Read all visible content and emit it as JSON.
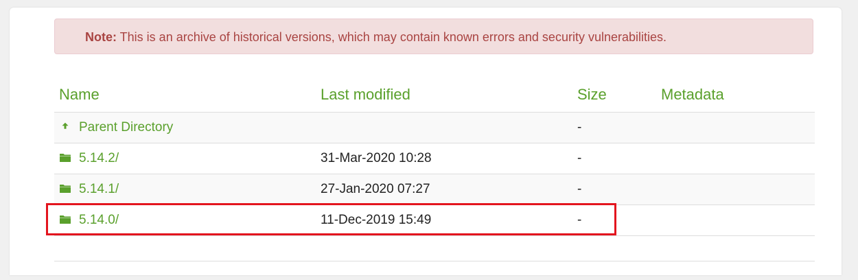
{
  "note": {
    "label": "Note:",
    "text": " This is an archive of historical versions, which may contain known errors and security vulnerabilities."
  },
  "table": {
    "headers": {
      "name": "Name",
      "modified": "Last modified",
      "size": "Size",
      "metadata": "Metadata"
    },
    "rows": [
      {
        "name": "Parent Directory",
        "modified": "",
        "size": "-",
        "icon": "arrow-up-icon"
      },
      {
        "name": "5.14.2/",
        "modified": "31-Mar-2020 10:28",
        "size": "-",
        "icon": "folder-icon"
      },
      {
        "name": "5.14.1/",
        "modified": "27-Jan-2020 07:27",
        "size": "-",
        "icon": "folder-icon"
      },
      {
        "name": "5.14.0/",
        "modified": "11-Dec-2019 15:49",
        "size": "-",
        "icon": "folder-icon"
      }
    ]
  },
  "colors": {
    "link": "#5aa02c",
    "note_text": "#a94442",
    "note_bg": "#f2dede",
    "highlight": "#e3141e"
  }
}
